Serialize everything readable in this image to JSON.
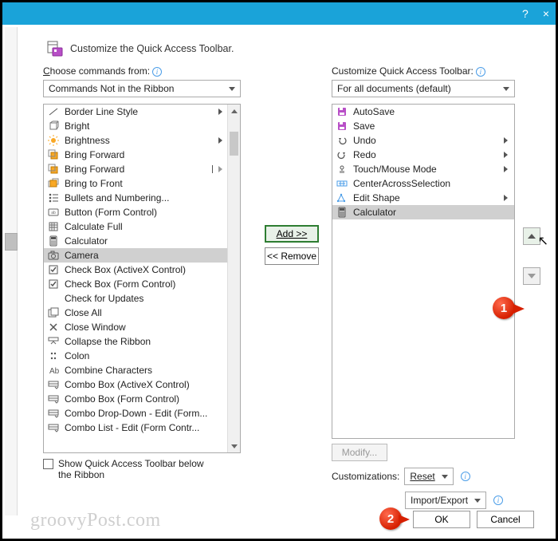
{
  "titlebar": {
    "help": "?",
    "close": "×"
  },
  "header": {
    "title": "Customize the Quick Access Toolbar."
  },
  "left": {
    "label_html": "Choose commands from:",
    "underline_letter": "C",
    "dropdown": "Commands Not in the Ribbon",
    "items": [
      {
        "label": "Border Line Style",
        "submenu": true,
        "icon": "line"
      },
      {
        "label": "Bright",
        "icon": "cube"
      },
      {
        "label": "Brightness",
        "icon": "sun",
        "submenu": true
      },
      {
        "label": "Bring Forward",
        "icon": "bring-forward"
      },
      {
        "label": "Bring Forward",
        "icon": "bring-forward",
        "thinSubmenu": true
      },
      {
        "label": "Bring to Front",
        "icon": "bring-front"
      },
      {
        "label": "Bullets and Numbering...",
        "icon": "bullets"
      },
      {
        "label": "Button (Form Control)",
        "icon": "button"
      },
      {
        "label": "Calculate Full",
        "icon": "calc-grid"
      },
      {
        "label": "Calculator",
        "icon": "calculator"
      },
      {
        "label": "Camera",
        "icon": "camera",
        "selected": true
      },
      {
        "label": "Check Box (ActiveX Control)",
        "icon": "checkbox-checked"
      },
      {
        "label": "Check Box (Form Control)",
        "icon": "checkbox-checked"
      },
      {
        "label": "Check for Updates",
        "icon": "blank"
      },
      {
        "label": "Close All",
        "icon": "close-all"
      },
      {
        "label": "Close Window",
        "icon": "close-x"
      },
      {
        "label": "Collapse the Ribbon",
        "icon": "collapse"
      },
      {
        "label": "Colon",
        "icon": "colon"
      },
      {
        "label": "Combine Characters",
        "icon": "combine"
      },
      {
        "label": "Combo Box (ActiveX Control)",
        "icon": "combo"
      },
      {
        "label": "Combo Box (Form Control)",
        "icon": "combo"
      },
      {
        "label": "Combo Drop-Down - Edit (Form...",
        "icon": "combo"
      },
      {
        "label": "Combo List - Edit (Form Contr...",
        "icon": "combo"
      },
      {
        "label": "",
        "icon": "blank",
        "cutoff": true
      }
    ],
    "show_below_label": "Show Quick Access Toolbar below the Ribbon"
  },
  "mid": {
    "add": "Add >>",
    "remove": "<< Remove"
  },
  "right": {
    "label": "Customize Quick Access Toolbar:",
    "dropdown": "For all documents (default)",
    "items": [
      {
        "label": "AutoSave",
        "icon": "save-purple"
      },
      {
        "label": "Save",
        "icon": "save-purple"
      },
      {
        "label": "Undo",
        "icon": "undo",
        "submenu": true
      },
      {
        "label": "Redo",
        "icon": "redo",
        "submenu": true
      },
      {
        "label": "Touch/Mouse Mode",
        "icon": "touch",
        "submenu": true
      },
      {
        "label": "CenterAcrossSelection",
        "icon": "center-across"
      },
      {
        "label": "Edit Shape",
        "icon": "edit-shape",
        "submenu": true
      },
      {
        "label": "Calculator",
        "icon": "calculator",
        "selected": true
      }
    ],
    "modify": "Modify...",
    "customizations_label": "Customizations:",
    "reset": "Reset",
    "import_export": "Import/Export"
  },
  "buttons": {
    "ok": "OK",
    "cancel": "Cancel"
  },
  "callouts": {
    "one": "1",
    "two": "2"
  },
  "watermark": "groovyPost.com"
}
